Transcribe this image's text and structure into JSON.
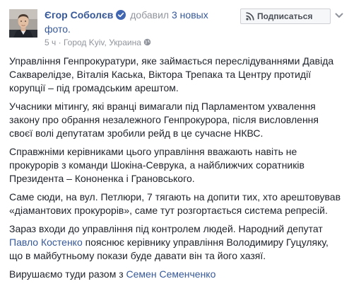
{
  "post": {
    "author": "Єгор Соболєв",
    "action_prefix": "добавил",
    "action_link": "3 новых",
    "action_suffix": "фото.",
    "time": "5 ч",
    "separator": "·",
    "location": "Город Kyiv, Украина",
    "location_icon": "globe-icon",
    "subscribe_label": "Подписаться",
    "subscribe_icon": "rss-icon",
    "menu_icon": "chevron-down-icon"
  },
  "body": {
    "p1": "Управління Генпрокуратури, яке займається переслідуваннями Давіда Сакварелідзе, Віталія Каська, Віктора Трепака та Центру протидії корупції – під громадським арештом.",
    "p2": "Учасники мітингу, які вранці вимагали під Парламентом ухвалення закону про обрання незалежного Генпрокурора, після висловлення своєї волі депутатам зробили рейд в це сучасне НКВС.",
    "p3": "Справжніми керівниками цього управління вважають навіть не прокурорів з команди Шокіна-Севрука, а найближчих соратників Президента – Кононенка і Грановського.",
    "p4": "Саме сюди, на вул. Петлюри, 7 тягають на допити тих, хто арештовував «діамантових прокурорів», саме тут розгортається система репресій.",
    "p5_before": "Зараз входи до управління під контролем людей. Народний депутат ",
    "p5_mention": "Павло Костенко",
    "p5_after": " пояснює керівнику управління Володимиру Гуцуляку, що в майбутньому покази буде давати він та його хазяї.",
    "p6_before": "Вирушаємо туди разом з ",
    "p6_mention": "Семен Семенченко"
  },
  "colors": {
    "link": "#365899",
    "muted": "#90949c",
    "text": "#1d2129",
    "verified": "#4267b2"
  }
}
